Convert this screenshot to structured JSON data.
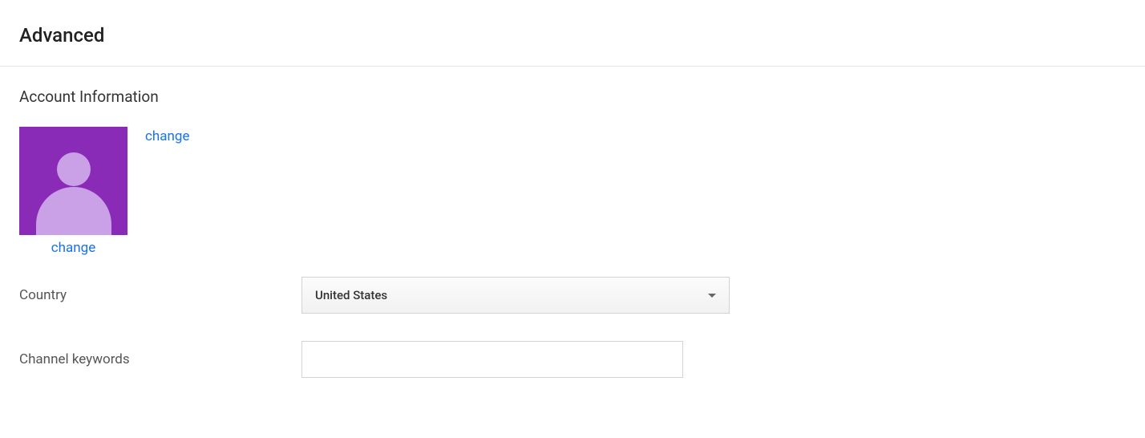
{
  "page": {
    "title": "Advanced"
  },
  "account": {
    "section_title": "Account Information",
    "change_avatar_link": "change",
    "change_name_link": "change"
  },
  "form": {
    "country": {
      "label": "Country",
      "value": "United States"
    },
    "channel_keywords": {
      "label": "Channel keywords",
      "value": ""
    }
  }
}
